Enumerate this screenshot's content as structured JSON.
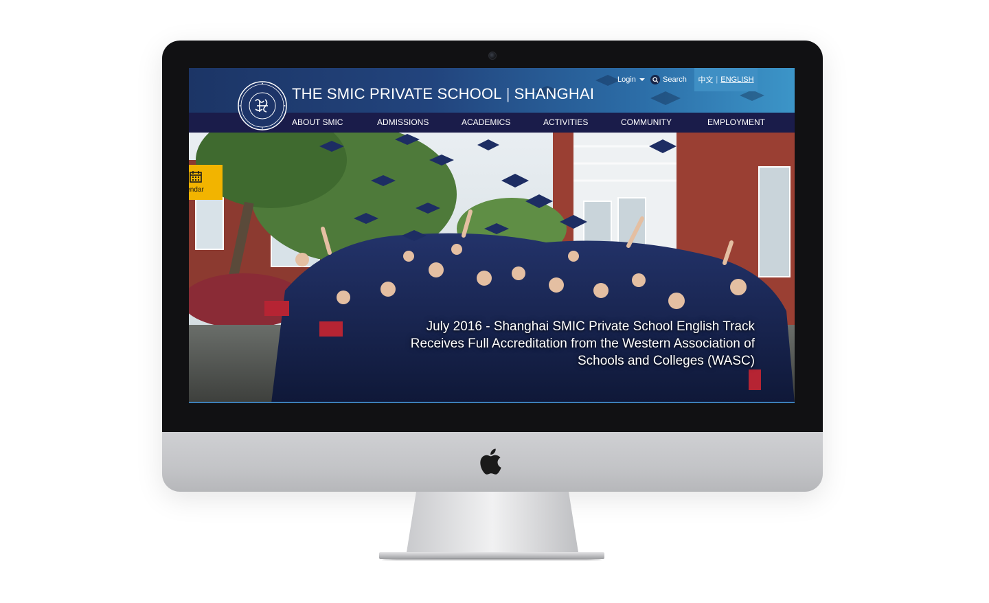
{
  "site": {
    "school_name": "THE SMIC PRIVATE SCHOOL",
    "separator": "|",
    "city": "SHANGHAI"
  },
  "utility": {
    "login_label": "Login",
    "search_label": "Search",
    "lang_zh": "中文",
    "lang_divider": "|",
    "lang_en": "ENGLISH"
  },
  "nav": {
    "items": [
      {
        "label": "ABOUT SMIC"
      },
      {
        "label": "ADMISSIONS"
      },
      {
        "label": "ACADEMICS"
      },
      {
        "label": "ACTIVITIES"
      },
      {
        "label": "COMMUNITY"
      },
      {
        "label": "EMPLOYMENT"
      }
    ]
  },
  "hero": {
    "calendar_label": "lendar",
    "caption": "July 2016 - Shanghai SMIC Private School English Track Receives Full Accreditation from the Western Association of Schools and Colleges (WASC)"
  },
  "colors": {
    "header_dark": "#1c3566",
    "header_light": "#3c95c8",
    "nav_bg": "#1a1c4a",
    "calendar_accent": "#f2b400",
    "lang_box": "#3f8fc4"
  },
  "icons": {
    "login": "caret-down-icon",
    "search": "search-icon",
    "calendar": "calendar-icon",
    "device": "apple-logo-icon"
  }
}
